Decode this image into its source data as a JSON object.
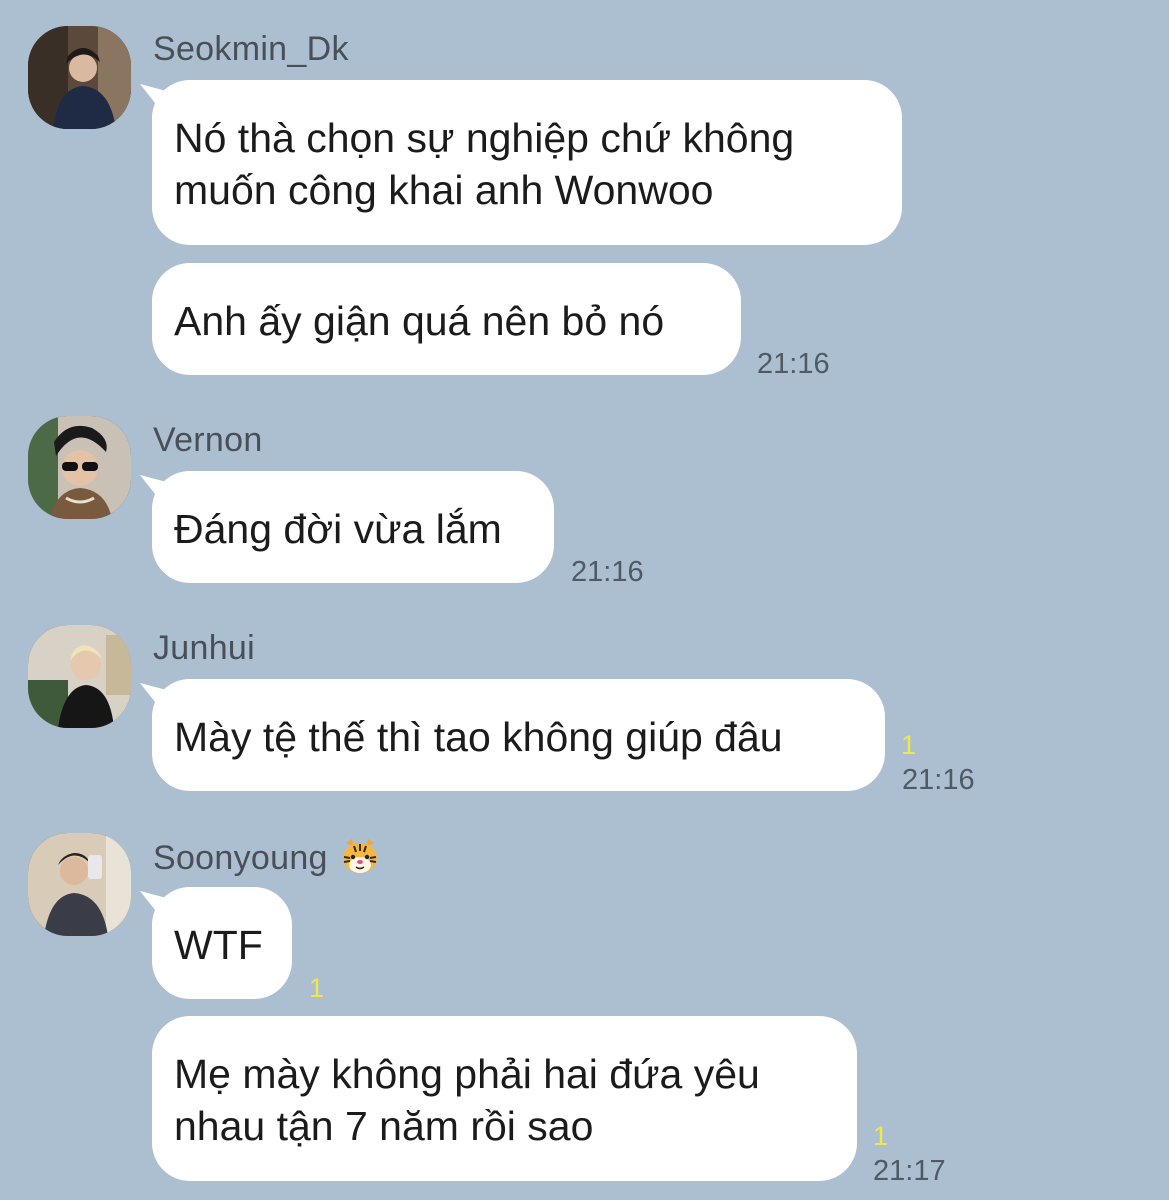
{
  "messages": [
    {
      "sender": "Seokmin_Dk",
      "bubbles": [
        {
          "text": "Nó thà chọn sự nghiệp chứ không\nmuốn công khai anh Wonwoo"
        },
        {
          "text": "Anh ấy giận quá nên bỏ nó"
        }
      ],
      "time": "21:16"
    },
    {
      "sender": "Vernon",
      "bubbles": [
        {
          "text": "Đáng đời vừa lắm"
        }
      ],
      "time": "21:16"
    },
    {
      "sender": "Junhui",
      "bubbles": [
        {
          "text": "Mày tệ thế thì tao không giúp đâu",
          "read_count": "1"
        }
      ],
      "time": "21:16"
    },
    {
      "sender": "Soonyoung",
      "sender_emoji": "tiger-face-icon",
      "bubbles": [
        {
          "text": "WTF",
          "read_count": "1"
        },
        {
          "text": "Mẹ mày không phải hai đứa yêu\nnhau tận 7 năm rồi sao",
          "read_count": "1"
        }
      ],
      "time": "21:17"
    }
  ],
  "colors": {
    "background": "#acbfd1",
    "bubble": "#ffffff",
    "read_indicator": "#f2e74a",
    "timestamp": "#4f5a66"
  }
}
